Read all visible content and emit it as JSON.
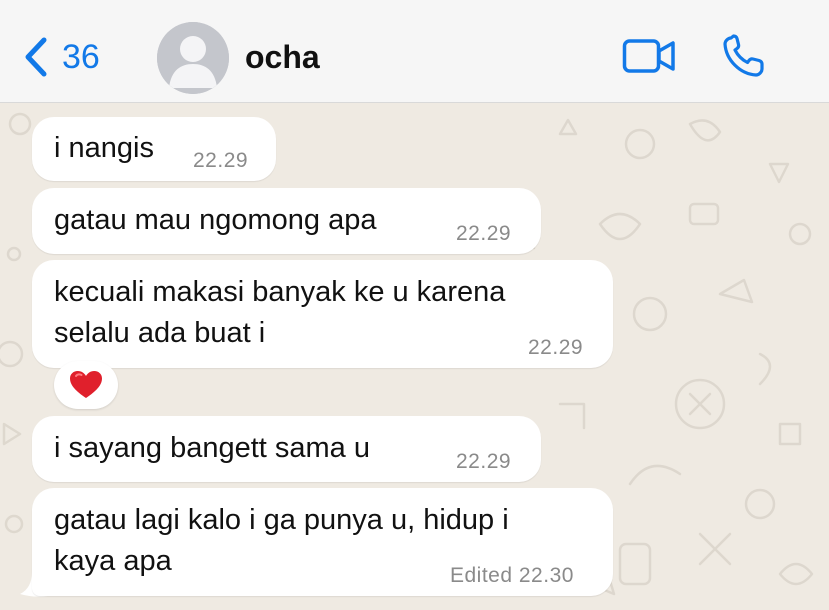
{
  "header": {
    "back_count": "36",
    "contact_name": "ocha"
  },
  "messages": [
    {
      "text": "i nangis",
      "time": "22.29"
    },
    {
      "text": "gatau mau ngomong apa",
      "time": "22.29"
    },
    {
      "text_line1": "kecuali makasi banyak ke u karena",
      "text_line2": "selalu ada buat i",
      "time": "22.29",
      "reaction": "heart"
    },
    {
      "text": "i sayang bangett sama u",
      "time": "22.29"
    },
    {
      "text_line1": "gatau lagi kalo i ga punya u, hidup i",
      "text_line2": "kaya apa",
      "time": "Edited 22.30"
    }
  ],
  "colors": {
    "accent": "#1279e8",
    "chat_background": "#efeae2",
    "bubble": "#ffffff",
    "heart": "#e0202c"
  },
  "icons": {
    "back": "chevron-left-icon",
    "video": "video-camera-icon",
    "call": "phone-icon",
    "avatar": "person-silhouette-icon",
    "reaction": "red-heart-icon"
  }
}
